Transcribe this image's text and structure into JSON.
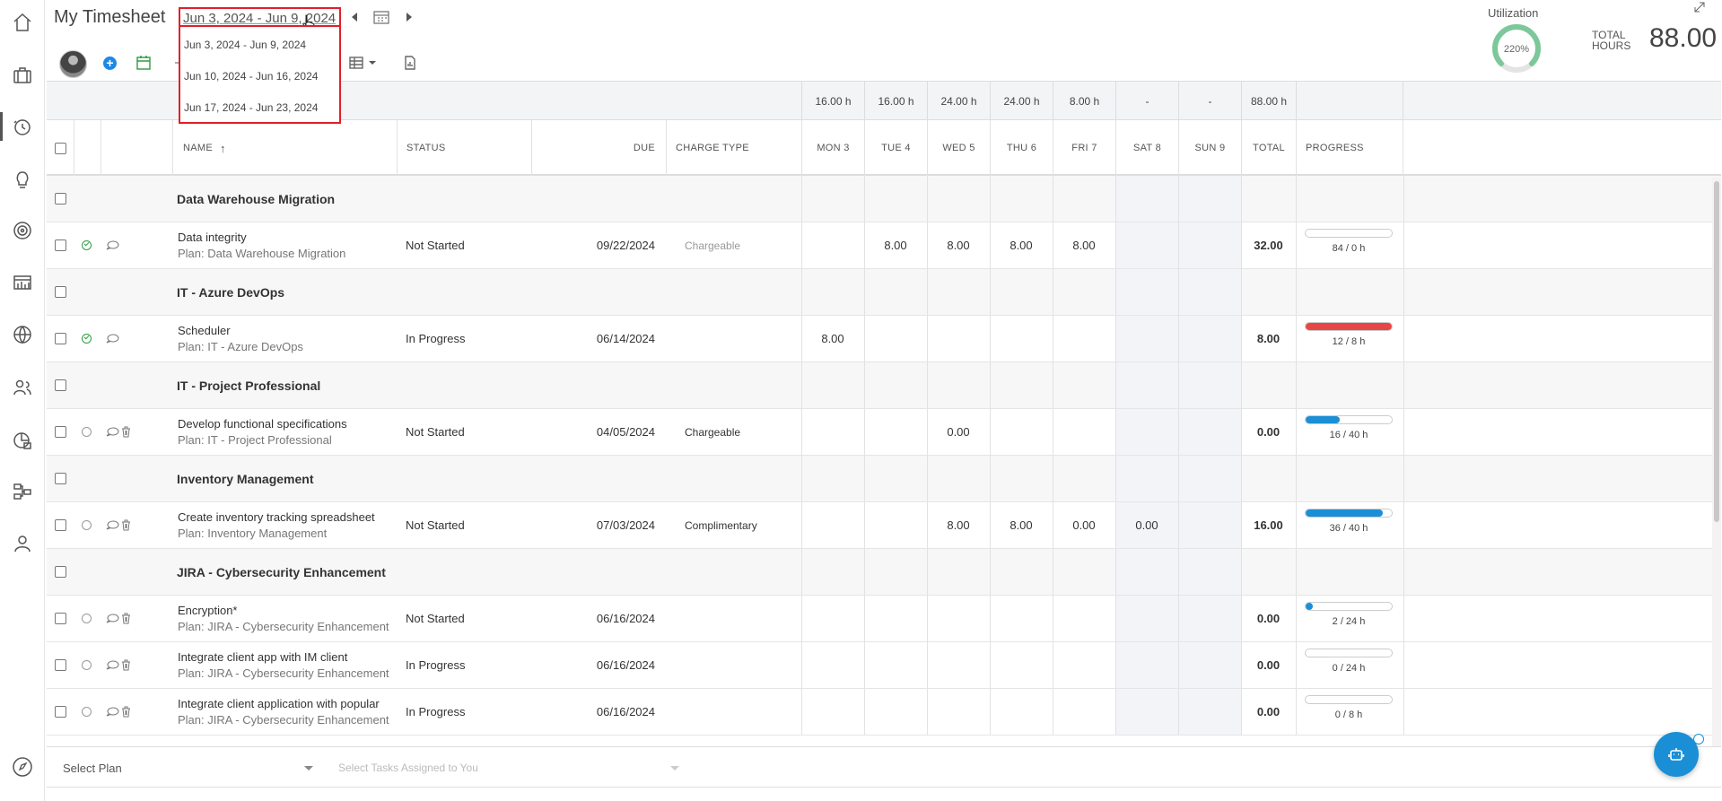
{
  "header": {
    "title": "My Timesheet",
    "date_range": "Jun 3, 2024 - Jun 9, 2024",
    "date_options": [
      "Jun 3, 2024 - Jun 9, 2024",
      "Jun 10, 2024 - Jun 16, 2024",
      "Jun 17, 2024 - Jun 23, 2024"
    ]
  },
  "utilization": {
    "label": "Utilization",
    "value": "220%",
    "fraction": 1.0
  },
  "total_hours": {
    "label": "TOTAL HOURS",
    "value": "88.00"
  },
  "columns": {
    "name": "NAME",
    "status": "STATUS",
    "due": "DUE",
    "charge_type": "CHARGE TYPE",
    "days": [
      "MON 3",
      "TUE 4",
      "WED 5",
      "THU 6",
      "FRI 7",
      "SAT 8",
      "SUN 9"
    ],
    "total": "TOTAL",
    "progress": "PROGRESS"
  },
  "day_totals": [
    "16.00 h",
    "16.00 h",
    "24.00 h",
    "24.00 h",
    "8.00 h",
    "-",
    "-"
  ],
  "grand_total": "88.00 h",
  "rows": [
    {
      "type": "group",
      "name": "Data Warehouse Migration"
    },
    {
      "type": "task",
      "name": "Data integrity",
      "plan": "Plan: Data Warehouse Migration",
      "status": "Not Started",
      "due": "09/22/2024",
      "charge": "Chargeable",
      "charge_muted": true,
      "days": [
        "",
        "8.00",
        "8.00",
        "8.00",
        "8.00",
        "",
        ""
      ],
      "total": "32.00",
      "progress_text": "84 / 0 h",
      "progress": 0,
      "progress_color": "#1a8fd6",
      "complete": true,
      "trash": false
    },
    {
      "type": "group",
      "name": "IT - Azure DevOps"
    },
    {
      "type": "task",
      "name": "Scheduler",
      "plan": "Plan: IT - Azure DevOps",
      "status": "In Progress",
      "due": "06/14/2024",
      "charge": "",
      "charge_muted": false,
      "days": [
        "8.00",
        "",
        "",
        "",
        "",
        "",
        ""
      ],
      "total": "8.00",
      "progress_text": "12 / 8 h",
      "progress": 1.0,
      "progress_color": "#e84545",
      "complete": true,
      "trash": false
    },
    {
      "type": "group",
      "name": "IT - Project Professional"
    },
    {
      "type": "task",
      "name": "Develop functional specifications",
      "plan": "Plan: IT - Project Professional",
      "status": "Not Started",
      "due": "04/05/2024",
      "charge": "Chargeable",
      "charge_muted": false,
      "days": [
        "",
        "",
        "0.00",
        "",
        "",
        "",
        ""
      ],
      "total": "0.00",
      "progress_text": "16 / 40 h",
      "progress": 0.4,
      "progress_color": "#1a8fd6",
      "complete": false,
      "trash": true
    },
    {
      "type": "group",
      "name": "Inventory Management"
    },
    {
      "type": "task",
      "name": "Create inventory tracking spreadsheet",
      "plan": "Plan: Inventory Management",
      "status": "Not Started",
      "due": "07/03/2024",
      "charge": "Complimentary",
      "charge_muted": false,
      "days": [
        "",
        "",
        "8.00",
        "8.00",
        "0.00",
        "0.00",
        ""
      ],
      "total": "16.00",
      "progress_text": "36 / 40 h",
      "progress": 0.9,
      "progress_color": "#1a8fd6",
      "complete": false,
      "trash": true
    },
    {
      "type": "group",
      "name": "JIRA - Cybersecurity Enhancement"
    },
    {
      "type": "task",
      "name": "Encryption*",
      "plan": "Plan: JIRA - Cybersecurity Enhancement",
      "status": "Not Started",
      "due": "06/16/2024",
      "charge": "",
      "charge_muted": false,
      "days": [
        "",
        "",
        "",
        "",
        "",
        "",
        ""
      ],
      "total": "0.00",
      "progress_text": "2 / 24 h",
      "progress": 0.08,
      "progress_color": "#1a8fd6",
      "complete": false,
      "trash": true
    },
    {
      "type": "task",
      "name": "Integrate client app with IM client",
      "plan": "Plan: JIRA - Cybersecurity Enhancement",
      "status": "In Progress",
      "due": "06/16/2024",
      "charge": "",
      "charge_muted": false,
      "days": [
        "",
        "",
        "",
        "",
        "",
        "",
        ""
      ],
      "total": "0.00",
      "progress_text": "0 / 24 h",
      "progress": 0,
      "progress_color": "#1a8fd6",
      "complete": false,
      "trash": true
    },
    {
      "type": "task",
      "name": "Integrate client application with popular",
      "plan": "Plan: JIRA - Cybersecurity Enhancement",
      "status": "In Progress",
      "due": "06/16/2024",
      "charge": "",
      "charge_muted": false,
      "days": [
        "",
        "",
        "",
        "",
        "",
        "",
        ""
      ],
      "total": "0.00",
      "progress_text": "0 / 8 h",
      "progress": 0,
      "progress_color": "#1a8fd6",
      "complete": false,
      "trash": true
    }
  ],
  "bottom": {
    "select_plan": "Select Plan",
    "select_tasks": "Select Tasks Assigned to You"
  },
  "icons": {
    "rail": [
      "home-icon",
      "briefcase-icon",
      "timesheet-clock-icon",
      "lightbulb-icon",
      "target-icon",
      "report-icon",
      "globe-icon",
      "people-icon",
      "analytics-icon",
      "hierarchy-icon",
      "user-icon"
    ],
    "accent": "#1a8fd6"
  }
}
